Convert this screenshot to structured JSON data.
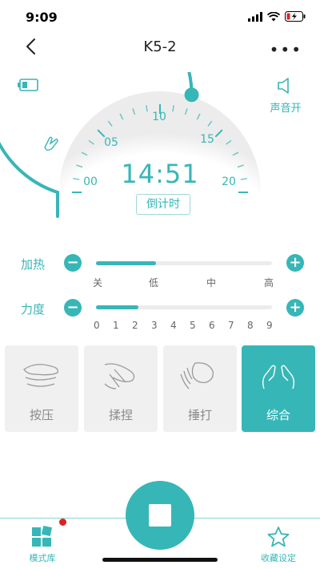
{
  "status": {
    "time": "9:09"
  },
  "nav": {
    "title": "K5-2"
  },
  "dial": {
    "time": "14:51",
    "countdown_label": "倒计时",
    "tick_labels": [
      "00",
      "05",
      "10",
      "15",
      "20"
    ],
    "progress_fraction": 0.6
  },
  "sound": {
    "label": "声音开"
  },
  "heat": {
    "label": "加热",
    "levels": [
      "关",
      "低",
      "中",
      "高"
    ],
    "fill_fraction": 0.34
  },
  "force": {
    "label": "力度",
    "levels": [
      "0",
      "1",
      "2",
      "3",
      "4",
      "5",
      "6",
      "7",
      "8",
      "9"
    ],
    "fill_fraction": 0.24
  },
  "modes": [
    {
      "label": "按压",
      "active": false
    },
    {
      "label": "揉捏",
      "active": false
    },
    {
      "label": "捶打",
      "active": false
    },
    {
      "label": "综合",
      "active": true
    }
  ],
  "tabbar": {
    "left_label": "模式库",
    "right_label": "收藏设定"
  },
  "colors": {
    "accent": "#37b6b7",
    "badge": "#e02020"
  }
}
